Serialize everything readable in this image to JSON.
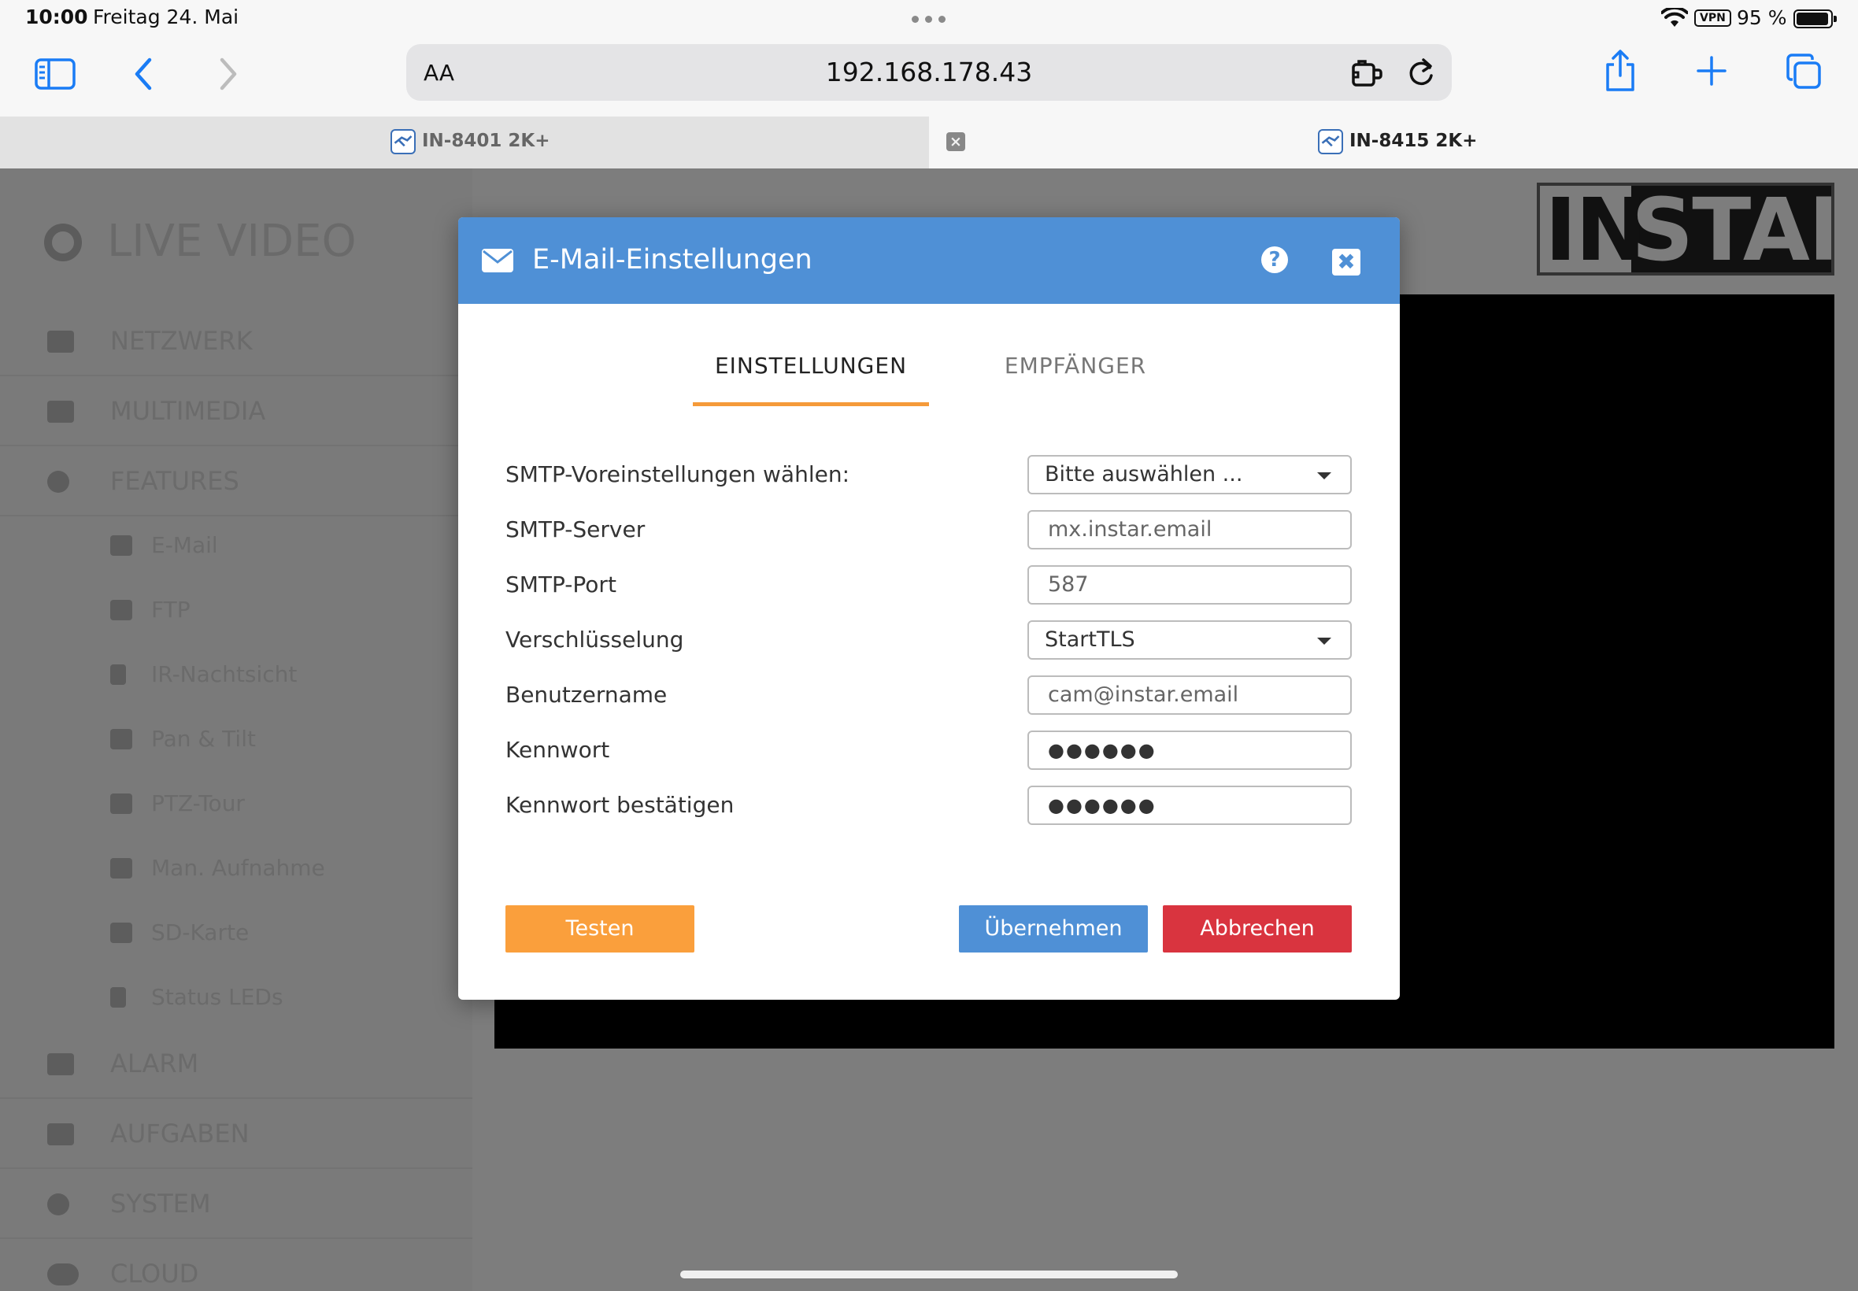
{
  "status": {
    "time": "10:00",
    "date": "Freitag 24. Mai",
    "vpn": "VPN",
    "battery_text": "95 %",
    "battery_level": 0.95
  },
  "browser": {
    "text_size": "AA",
    "url": "192.168.178.43",
    "tabs": [
      {
        "title": "IN-8401 2K+"
      },
      {
        "title": "IN-8415 2K+"
      }
    ],
    "tab_close": "×"
  },
  "page": {
    "live_title": "LIVE VIDEO",
    "menu": [
      "NETZWERK",
      "MULTIMEDIA",
      "FEATURES"
    ],
    "submenu": [
      "E-Mail",
      "FTP",
      "IR-Nachtsicht",
      "Pan & Tilt",
      "PTZ-Tour",
      "Man. Aufnahme",
      "SD-Karte",
      "Status LEDs"
    ],
    "menu_bottom": [
      "ALARM",
      "AUFGABEN",
      "SYSTEM",
      "CLOUD"
    ],
    "logo_left": "IN",
    "logo_right": "STAR"
  },
  "modal": {
    "title": "E-Mail-Einstellungen",
    "help": "?",
    "close": "✖",
    "tabs": {
      "settings": "EINSTELLUNGEN",
      "recipients": "EMPFÄNGER"
    },
    "fields": {
      "preset_label": "SMTP-Voreinstellungen wählen:",
      "preset_value": "Bitte auswählen ...",
      "server_label": "SMTP-Server",
      "server_value": "mx.instar.email",
      "port_label": "SMTP-Port",
      "port_value": "587",
      "encryption_label": "Verschlüsselung",
      "encryption_value": "StartTLS",
      "username_label": "Benutzername",
      "username_value": "cam@instar.email",
      "password_label": "Kennwort",
      "password_value": "●●●●●●",
      "confirm_label": "Kennwort bestätigen",
      "confirm_value": "●●●●●●"
    },
    "buttons": {
      "test": "Testen",
      "apply": "Übernehmen",
      "cancel": "Abbrechen"
    }
  },
  "colors": {
    "header_blue": "#4f90d6",
    "tab_underline": "#f59a3a",
    "test_orange": "#fa9f3c",
    "cancel_red": "#d9343f",
    "ios_blue": "#1a7cf5"
  }
}
